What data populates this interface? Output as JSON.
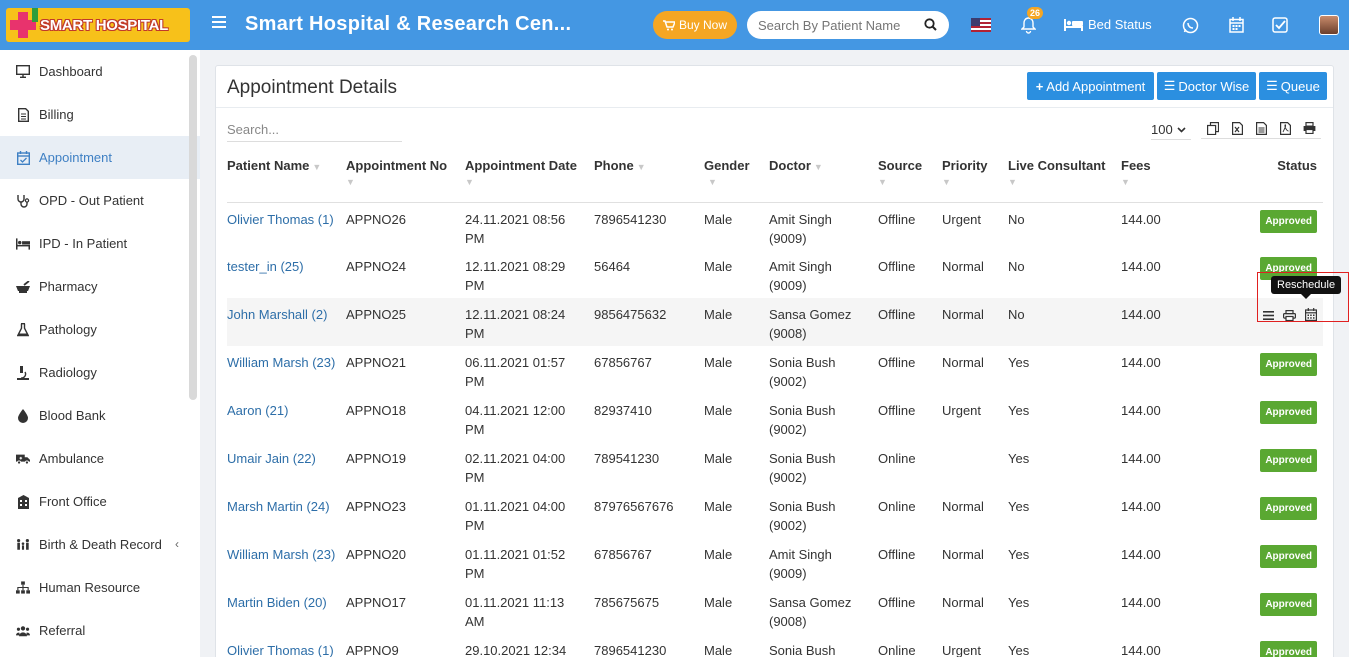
{
  "header": {
    "logo_text": "SMART HOSPITAL",
    "app_title": "Smart Hospital & Research Cen...",
    "buy_now": "Buy Now",
    "search_placeholder": "Search By Patient Name",
    "notification_count": "26",
    "bed_status": "Bed Status"
  },
  "sidebar": {
    "items": [
      {
        "label": "Dashboard",
        "icon": "monitor-icon"
      },
      {
        "label": "Billing",
        "icon": "invoice-icon"
      },
      {
        "label": "Appointment",
        "icon": "calendar-check-icon"
      },
      {
        "label": "OPD - Out Patient",
        "icon": "stethoscope-icon"
      },
      {
        "label": "IPD - In Patient",
        "icon": "procedures-icon"
      },
      {
        "label": "Pharmacy",
        "icon": "mortar-pestle-icon"
      },
      {
        "label": "Pathology",
        "icon": "flask-icon"
      },
      {
        "label": "Radiology",
        "icon": "microscope-icon"
      },
      {
        "label": "Blood Bank",
        "icon": "drop-icon"
      },
      {
        "label": "Ambulance",
        "icon": "ambulance-icon"
      },
      {
        "label": "Front Office",
        "icon": "building-icon"
      },
      {
        "label": "Birth & Death Record",
        "icon": "family-icon"
      },
      {
        "label": "Human Resource",
        "icon": "sitemap-icon"
      },
      {
        "label": "Referral",
        "icon": "users-icon"
      }
    ]
  },
  "panel": {
    "title": "Appointment Details",
    "add_appointment": "Add Appointment",
    "doctor_wise": "Doctor Wise",
    "queue": "Queue",
    "search_placeholder": "Search...",
    "page_length": "100"
  },
  "table": {
    "headers": [
      "Patient Name",
      "Appointment No",
      "Appointment Date",
      "Phone",
      "Gender",
      "Doctor",
      "Source",
      "Priority",
      "Live Consultant",
      "Fees",
      "Status"
    ],
    "rows": [
      {
        "patient": "Olivier Thomas (1)",
        "no": "APPNO26",
        "date": "24.11.2021 08:56",
        "time": "PM",
        "phone": "7896541230",
        "gender": "Male",
        "doctor": "Amit Singh",
        "doctor_id": "(9009)",
        "source": "Offline",
        "priority": "Urgent",
        "live": "No",
        "fees": "144.00",
        "status": "Approved"
      },
      {
        "patient": "tester_in (25)",
        "no": "APPNO24",
        "date": "12.11.2021 08:29",
        "time": "PM",
        "phone": "56464",
        "gender": "Male",
        "doctor": "Amit Singh",
        "doctor_id": "(9009)",
        "source": "Offline",
        "priority": "Normal",
        "live": "No",
        "fees": "144.00",
        "status": "Approved"
      },
      {
        "patient": "John Marshall (2)",
        "no": "APPNO25",
        "date": "12.11.2021 08:24",
        "time": "PM",
        "phone": "9856475632",
        "gender": "Male",
        "doctor": "Sansa Gomez",
        "doctor_id": "(9008)",
        "source": "Offline",
        "priority": "Normal",
        "live": "No",
        "fees": "144.00",
        "status": ""
      },
      {
        "patient": "William Marsh (23)",
        "no": "APPNO21",
        "date": "06.11.2021 01:57",
        "time": "PM",
        "phone": "67856767",
        "gender": "Male",
        "doctor": "Sonia Bush",
        "doctor_id": "(9002)",
        "source": "Offline",
        "priority": "Normal",
        "live": "Yes",
        "fees": "144.00",
        "status": "Approved"
      },
      {
        "patient": "Aaron (21)",
        "no": "APPNO18",
        "date": "04.11.2021 12:00",
        "time": "PM",
        "phone": "82937410",
        "gender": "Male",
        "doctor": "Sonia Bush",
        "doctor_id": "(9002)",
        "source": "Offline",
        "priority": "Urgent",
        "live": "Yes",
        "fees": "144.00",
        "status": "Approved"
      },
      {
        "patient": "Umair Jain (22)",
        "no": "APPNO19",
        "date": "02.11.2021 04:00",
        "time": "PM",
        "phone": "789541230",
        "gender": "Male",
        "doctor": "Sonia Bush",
        "doctor_id": "(9002)",
        "source": "Online",
        "priority": "",
        "live": "Yes",
        "fees": "144.00",
        "status": "Approved"
      },
      {
        "patient": "Marsh Martin (24)",
        "no": "APPNO23",
        "date": "01.11.2021 04:00",
        "time": "PM",
        "phone": "87976567676",
        "gender": "Male",
        "doctor": "Sonia Bush",
        "doctor_id": "(9002)",
        "source": "Online",
        "priority": "Normal",
        "live": "Yes",
        "fees": "144.00",
        "status": "Approved"
      },
      {
        "patient": "William Marsh (23)",
        "no": "APPNO20",
        "date": "01.11.2021 01:52",
        "time": "PM",
        "phone": "67856767",
        "gender": "Male",
        "doctor": "Amit Singh",
        "doctor_id": "(9009)",
        "source": "Offline",
        "priority": "Normal",
        "live": "Yes",
        "fees": "144.00",
        "status": "Approved"
      },
      {
        "patient": "Martin Biden (20)",
        "no": "APPNO17",
        "date": "01.11.2021 11:13",
        "time": "AM",
        "phone": "785675675",
        "gender": "Male",
        "doctor": "Sansa Gomez",
        "doctor_id": "(9008)",
        "source": "Offline",
        "priority": "Normal",
        "live": "Yes",
        "fees": "144.00",
        "status": "Approved"
      },
      {
        "patient": "Olivier Thomas (1)",
        "no": "APPNO9",
        "date": "29.10.2021 12:34",
        "time": "",
        "phone": "7896541230",
        "gender": "Male",
        "doctor": "Sonia Bush",
        "doctor_id": "",
        "source": "Online",
        "priority": "Urgent",
        "live": "Yes",
        "fees": "144.00",
        "status": "Approved"
      }
    ]
  },
  "tooltip": "Reschedule",
  "colors": {
    "header": "#4497e3",
    "accent": "#2b8fe0",
    "approved": "#5aa832",
    "buy_now": "#f5a623"
  }
}
